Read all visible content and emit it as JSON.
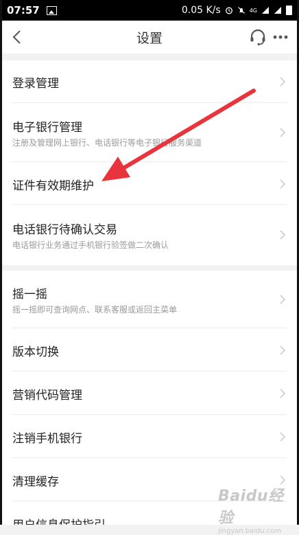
{
  "status_bar": {
    "time": "07:57",
    "network_speed": "0.05 K/s",
    "network_type": "4G",
    "icons": [
      "image-icon",
      "alarm-icon",
      "mute-icon",
      "signal-icon",
      "battery-icon"
    ]
  },
  "header": {
    "title": "设置",
    "back_icon": "chevron-left-icon",
    "headset_icon": "headset-icon",
    "more_icon": "more-icon"
  },
  "section1": {
    "items": [
      {
        "label": "登录管理",
        "description": ""
      },
      {
        "label": "电子银行管理",
        "description": "注册及管理网上银行、电话银行等电子银行服务渠道"
      },
      {
        "label": "证件有效期维护",
        "description": ""
      },
      {
        "label": "电话银行待确认交易",
        "description": "电话银行业务通过手机银行验签做二次确认"
      }
    ]
  },
  "section2": {
    "items": [
      {
        "label": "摇一摇",
        "description": "摇一摇即可查询网点、联系客服或返回主菜单"
      },
      {
        "label": "版本切换",
        "description": ""
      },
      {
        "label": "营销代码管理",
        "description": ""
      },
      {
        "label": "注销手机银行",
        "description": ""
      },
      {
        "label": "清理缓存",
        "description": ""
      },
      {
        "label": "用户信息保护指引",
        "description": ""
      }
    ]
  },
  "watermark": {
    "logo": "Baidu经验",
    "url": "jingyan.baidu.com"
  },
  "colors": {
    "accent_arrow": "#e8343c",
    "background": "#f2f2f2",
    "divider": "#ececec"
  }
}
